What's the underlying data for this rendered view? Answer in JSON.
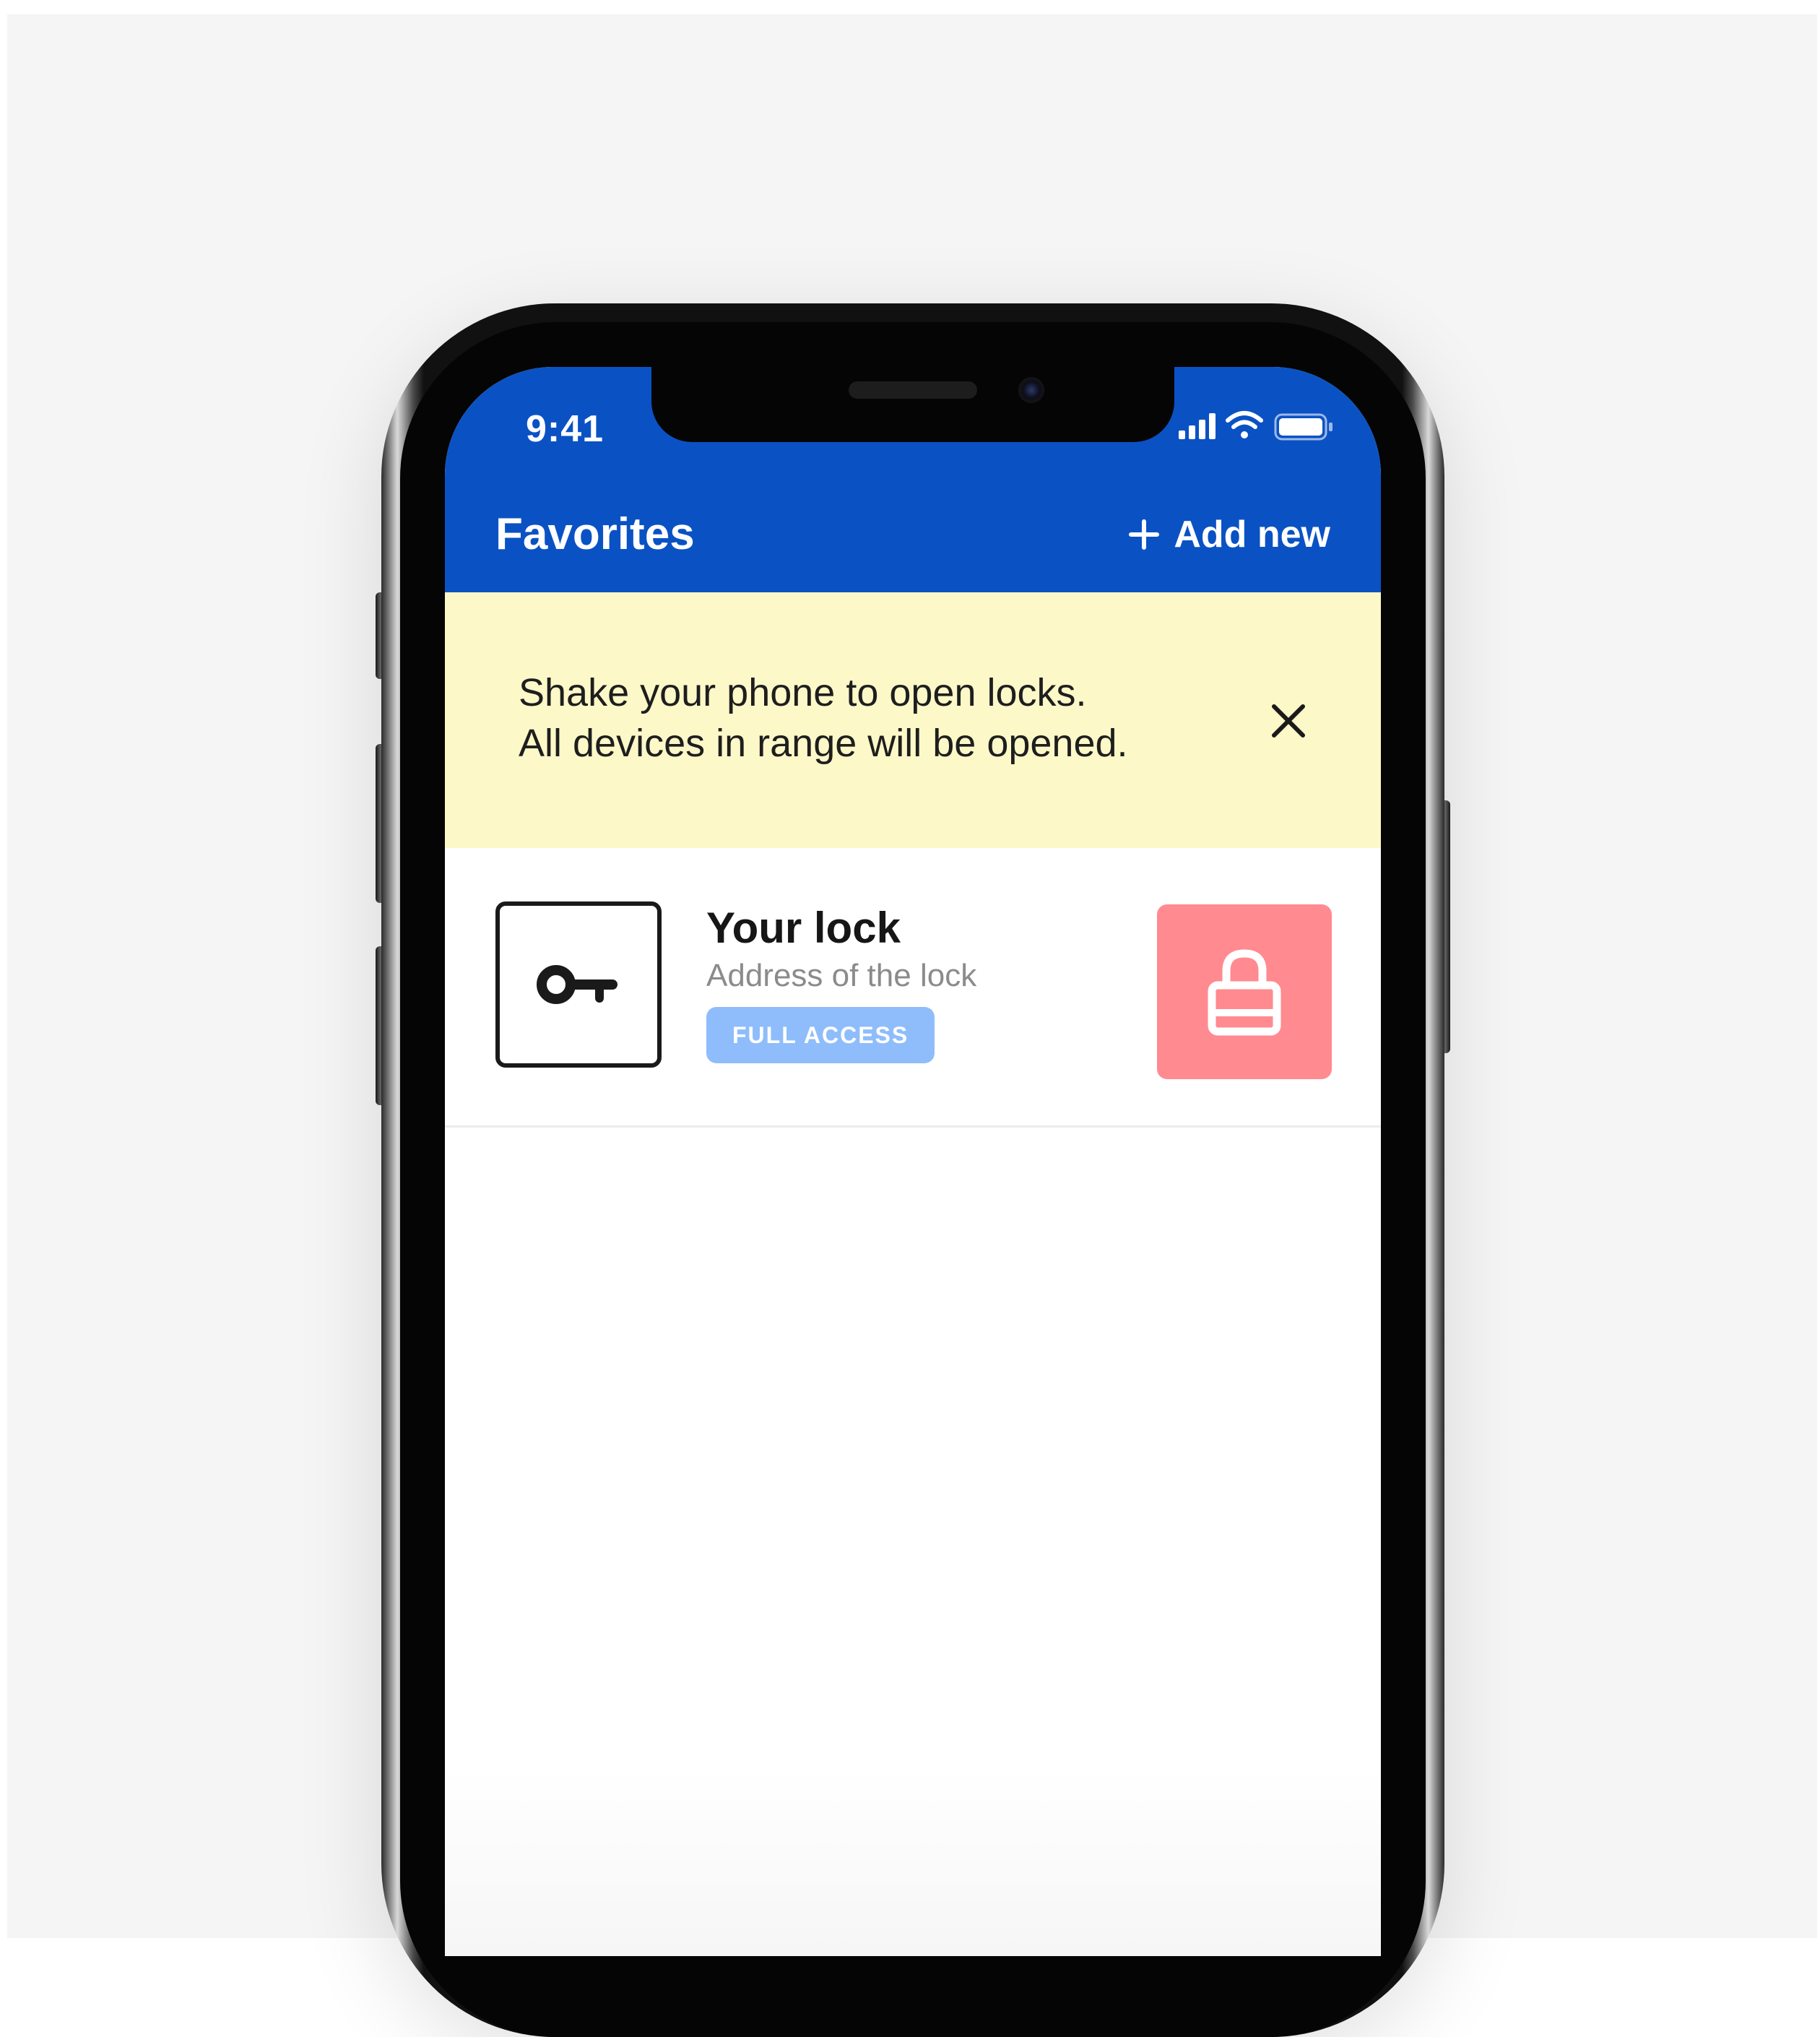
{
  "status_bar": {
    "time": "9:41"
  },
  "header": {
    "title": "Favorites",
    "add_label": "Add new",
    "background_color": "#0a52c4"
  },
  "banner": {
    "line1": "Shake your phone to open locks.",
    "line2": "All devices in range will be opened.",
    "background_color": "#fdf8c8",
    "close_icon": "close-icon"
  },
  "locks": [
    {
      "name": "Your lock",
      "address": "Address of the lock",
      "access_badge": "FULL ACCESS",
      "icon": "key-icon",
      "action_icon": "lock-icon",
      "action_color": "#ff8a90",
      "badge_color": "#8fbdfb"
    }
  ]
}
